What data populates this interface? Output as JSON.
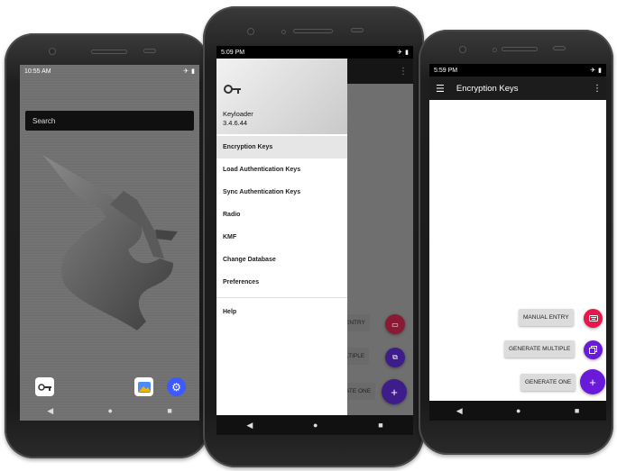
{
  "phone1": {
    "status_time": "10:55 AM",
    "search_label": "Search",
    "nav": {
      "back": "◀",
      "home": "●",
      "recents": "■"
    }
  },
  "phone2": {
    "status_time": "5:09 PM",
    "app_name": "Keyloader",
    "app_version": "3.4.6.44",
    "menu": [
      {
        "label": "Encryption Keys"
      },
      {
        "label": "Load Authentication Keys"
      },
      {
        "label": "Sync Authentication Keys"
      },
      {
        "label": "Radio"
      },
      {
        "label": "KMF"
      },
      {
        "label": "Change Database"
      },
      {
        "label": "Preferences"
      }
    ],
    "help_label": "Help",
    "chips": {
      "manual": "ENTRY",
      "multiple": "LTIPLE",
      "one": "ATE ONE"
    },
    "nav": {
      "back": "◀",
      "home": "●",
      "recents": "■"
    }
  },
  "phone3": {
    "status_time": "5:59 PM",
    "title": "Encryption Keys",
    "actions": {
      "manual_entry": "MANUAL ENTRY",
      "generate_multiple": "GENERATE MULTIPLE",
      "generate_one": "GENERATE ONE"
    },
    "nav": {
      "back": "◀",
      "home": "●",
      "recents": "■"
    }
  },
  "icons": {
    "airplane": "airplane-mode-icon",
    "battery": "battery-icon",
    "overflow": "overflow-menu-icon",
    "hamburger": "hamburger-menu-icon",
    "add": "add-icon",
    "key": "key-icon"
  },
  "colors": {
    "fab_red": "#e8174b",
    "fab_purple": "#6a1bd9",
    "fab_red_dim": "#8a1a34",
    "fab_purple_dim": "#3e1d8a",
    "appbar": "#1c1c1c"
  },
  "glyphs": {
    "plus": "+",
    "airplane": "✈",
    "battery": "▮",
    "overflow": "⋮",
    "hamburger": "☰",
    "gear": "⚙",
    "key": "🗝"
  }
}
